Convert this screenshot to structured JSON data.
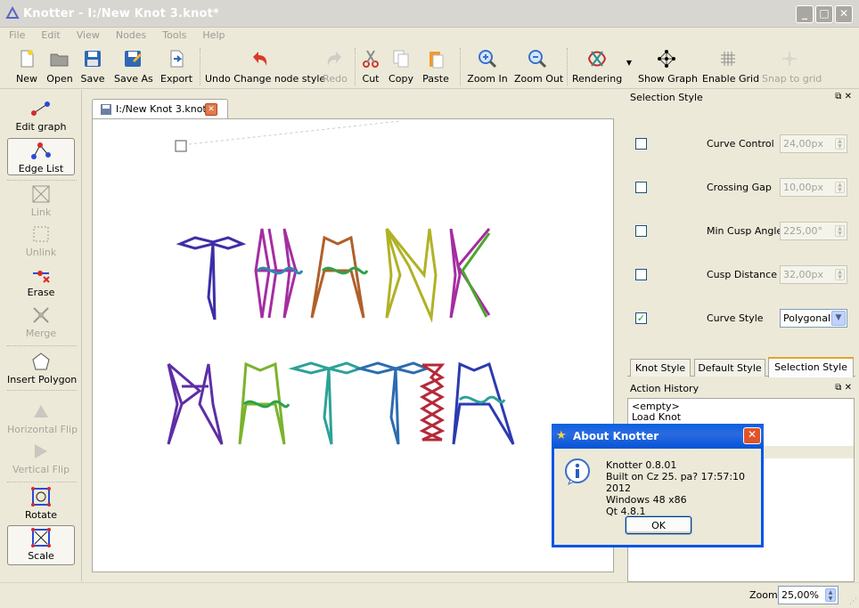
{
  "window": {
    "title": "Knotter - I:/New Knot 3.knot*",
    "minimize": "_",
    "maximize": "□",
    "close": "✕"
  },
  "menu": [
    "File",
    "Edit",
    "View",
    "Nodes",
    "Tools",
    "Help"
  ],
  "toolbar": {
    "new": "New",
    "open": "Open",
    "save": "Save",
    "save_as": "Save As",
    "export": "Export",
    "undo": "Undo Change node style",
    "redo": "Redo",
    "cut": "Cut",
    "copy": "Copy",
    "paste": "Paste",
    "zoom_in": "Zoom In",
    "zoom_out": "Zoom Out",
    "rendering": "Rendering",
    "show_graph": "Show Graph",
    "enable_grid": "Enable Grid",
    "snap_to_grid": "Snap to grid"
  },
  "left_tools": {
    "edit_graph": "Edit graph",
    "edge_list": "Edge List",
    "link": "Link",
    "unlink": "Unlink",
    "erase": "Erase",
    "merge": "Merge",
    "insert_polygon": "Insert Polygon",
    "horizontal_flip": "Horizontal Flip",
    "vertical_flip": "Vertical Flip",
    "rotate": "Rotate",
    "scale": "Scale"
  },
  "document_tab": "I:/New Knot 3.knot",
  "knot_text": {
    "line1": "THANK",
    "line2": "MATTIA"
  },
  "selection_style": {
    "title": "Selection Style",
    "rows": [
      {
        "label": "Curve Control",
        "value": "24,00px",
        "checked": false
      },
      {
        "label": "Crossing Gap",
        "value": "10,00px",
        "checked": false
      },
      {
        "label": "Min Cusp Angle",
        "value": "225,00°",
        "checked": false
      },
      {
        "label": "Cusp Distance",
        "value": "32,00px",
        "checked": false
      },
      {
        "label": "Curve Style",
        "value": "Polygonal",
        "checked": true
      }
    ],
    "tabs": [
      "Knot Style",
      "Default Style",
      "Selection Style"
    ]
  },
  "action_history": {
    "title": "Action History",
    "items": [
      "<empty>",
      "Load Knot"
    ]
  },
  "zoom": {
    "label": "Zoom",
    "value": "25,00%"
  },
  "about": {
    "title": "About Knotter",
    "lines": [
      "Knotter 0.8.01",
      "Built on Cz 25. pa? 17:57:10 2012",
      "Windows 48 x86",
      "Qt 4.8.1"
    ],
    "ok": "OK"
  },
  "colors": {
    "accent": "#0055e5",
    "tab_highlight": "#e6a32b"
  }
}
